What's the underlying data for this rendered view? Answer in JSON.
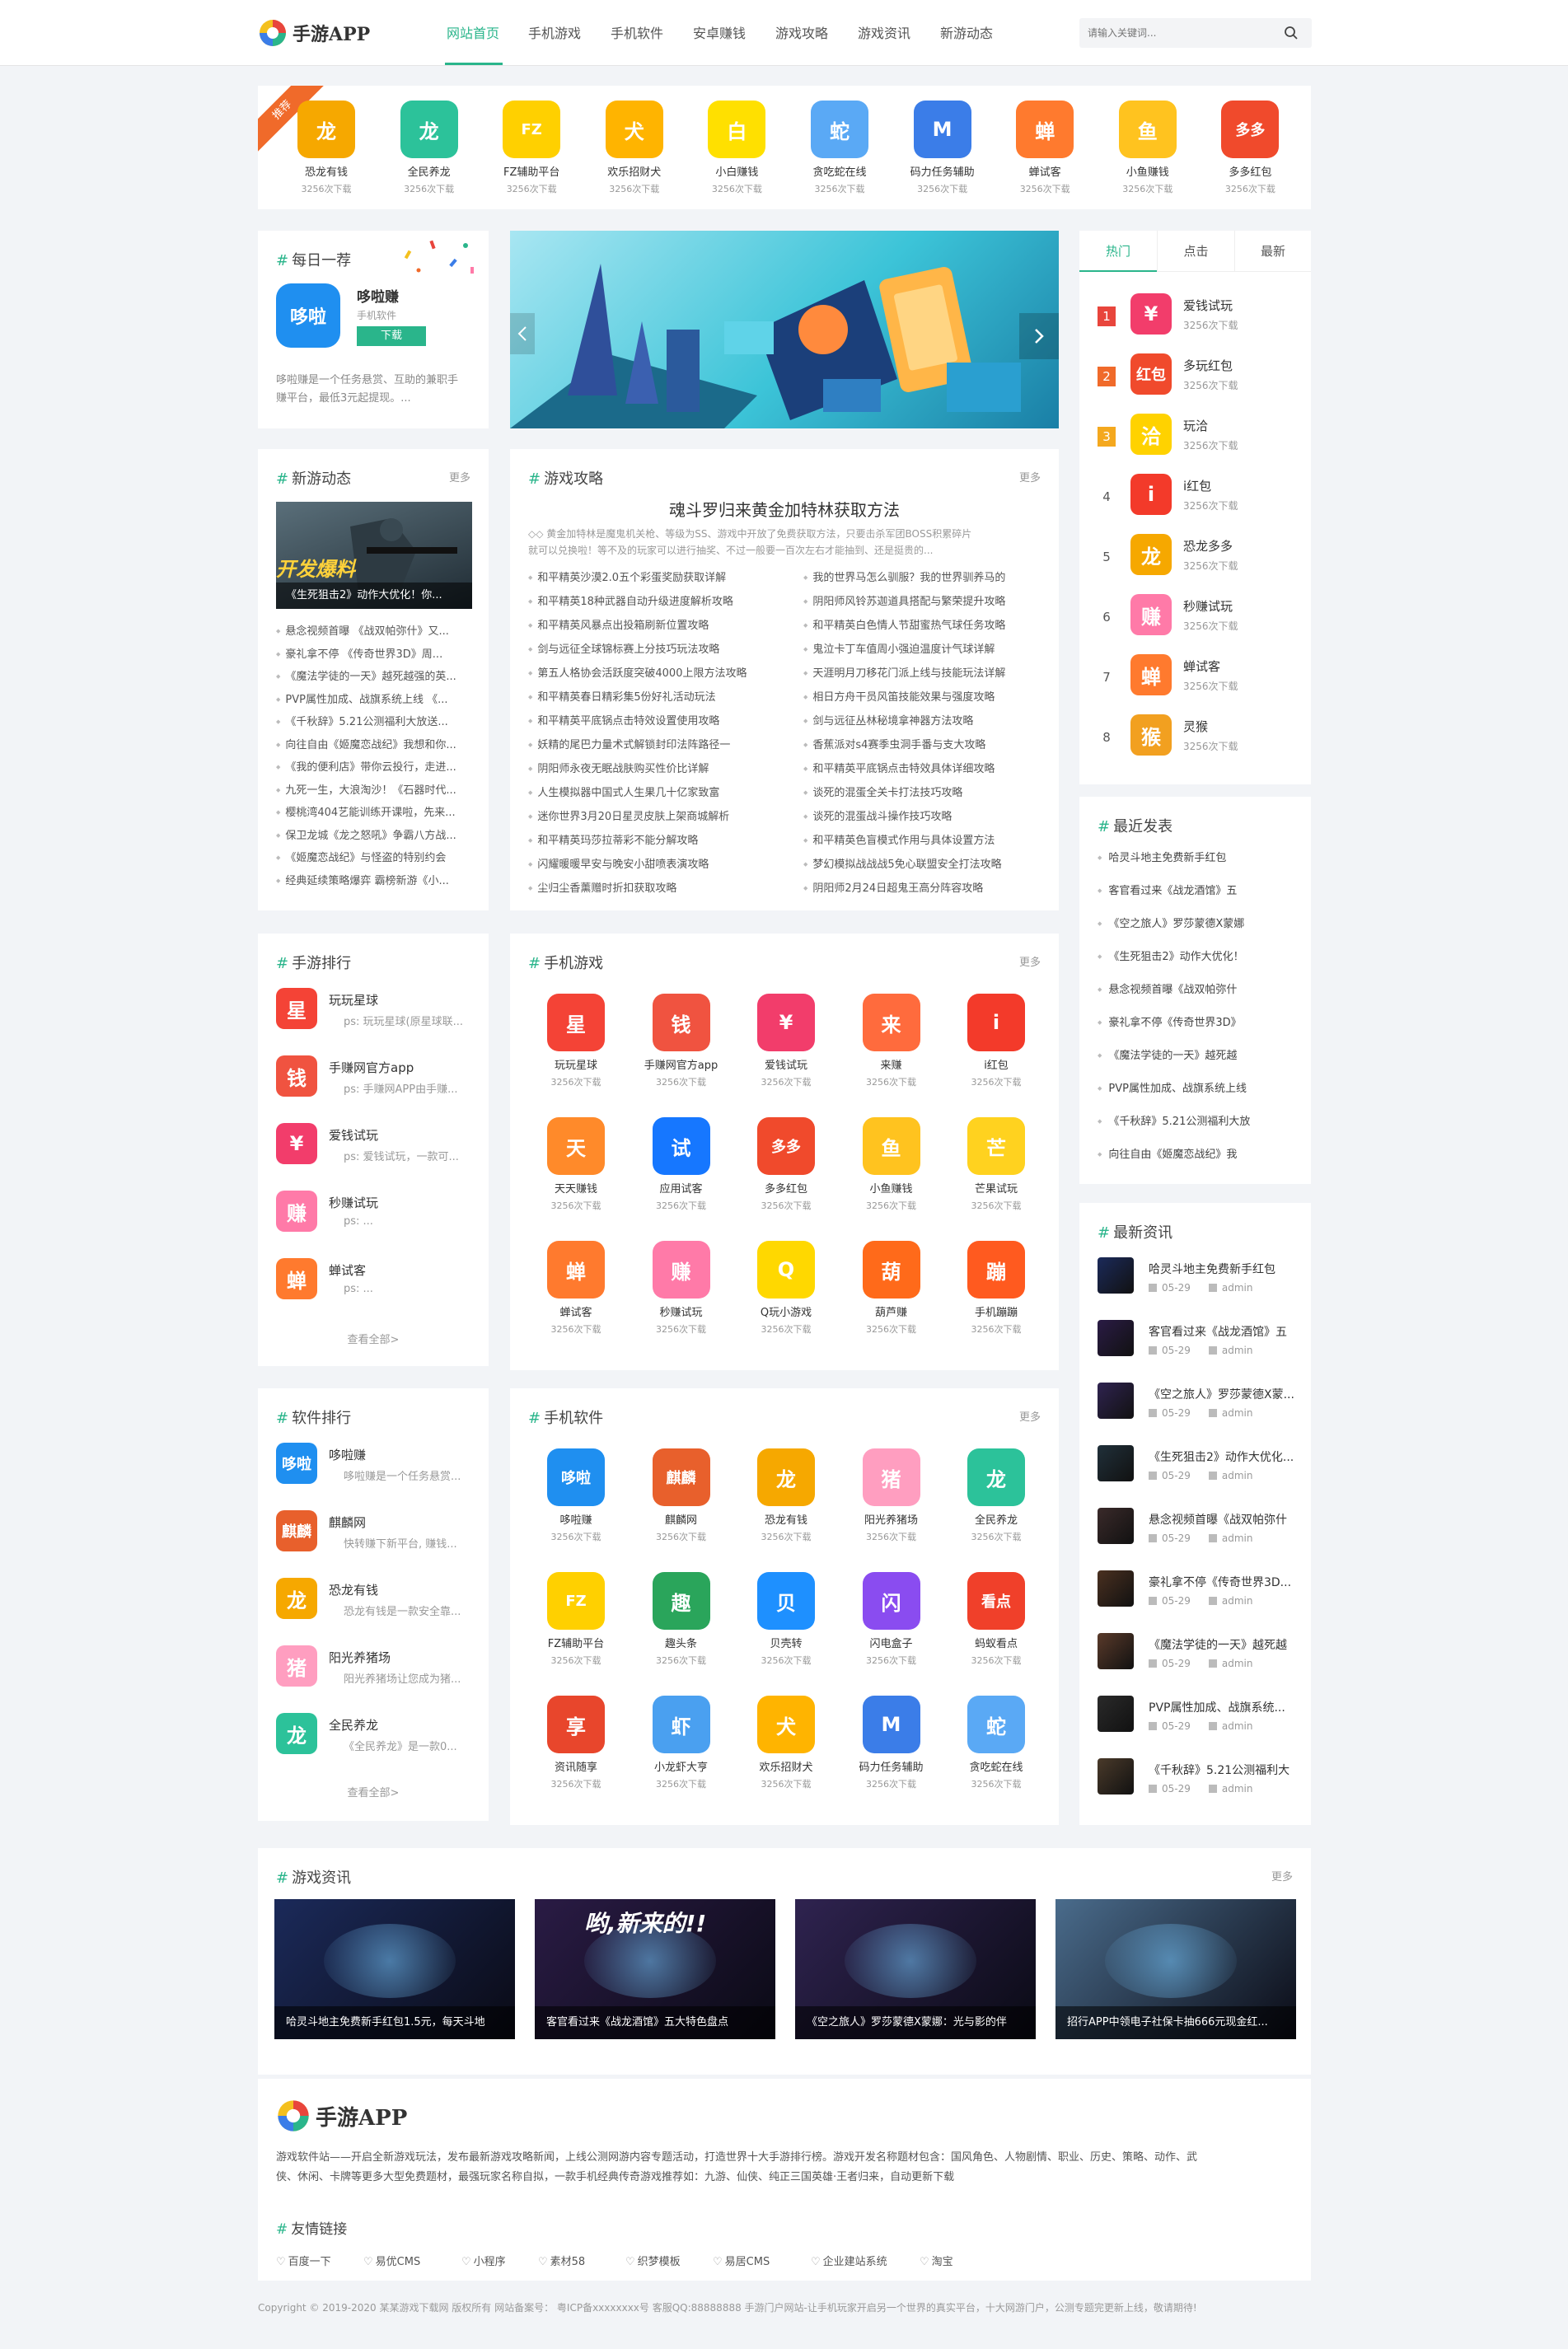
{
  "header": {
    "logo_text": "手游APP",
    "nav": [
      "网站首页",
      "手机游戏",
      "手机软件",
      "安卓赚钱",
      "游戏攻略",
      "游戏资讯",
      "新游动态"
    ],
    "search_placeholder": "请输入关键词..."
  },
  "top_apps": {
    "badge": "推荐",
    "items": [
      {
        "name": "恐龙有钱",
        "downloads": "3256次下载",
        "color": "#f6a800",
        "glyph": "龙"
      },
      {
        "name": "全民养龙",
        "downloads": "3256次下载",
        "color": "#2cc29a",
        "glyph": "龙"
      },
      {
        "name": "FZ辅助平台",
        "downloads": "3256次下载",
        "color": "#ffd000",
        "glyph": "FZ"
      },
      {
        "name": "欢乐招财犬",
        "downloads": "3256次下载",
        "color": "#ffb400",
        "glyph": "犬"
      },
      {
        "name": "小白赚钱",
        "downloads": "3256次下载",
        "color": "#ffe000",
        "glyph": "白"
      },
      {
        "name": "贪吃蛇在线",
        "downloads": "3256次下载",
        "color": "#5aa9f5",
        "glyph": "蛇"
      },
      {
        "name": "码力任务辅助",
        "downloads": "3256次下载",
        "color": "#3b7de8",
        "glyph": "M"
      },
      {
        "name": "蝉试客",
        "downloads": "3256次下载",
        "color": "#ff7a2e",
        "glyph": "蝉"
      },
      {
        "name": "小鱼赚钱",
        "downloads": "3256次下载",
        "color": "#ffc31f",
        "glyph": "鱼"
      },
      {
        "name": "多多红包",
        "downloads": "3256次下载",
        "color": "#f04a2c",
        "glyph": "多多"
      }
    ]
  },
  "daily": {
    "title": "每日一荐",
    "app_name": "哆啦赚",
    "app_cat": "手机软件",
    "icon_text": "哆啦",
    "download": "下载",
    "desc_line1": "哆啦赚是一个任务悬赏、互助的兼职手",
    "desc_line2": "赚平台，最低3元起提现。..."
  },
  "hot_tabs": [
    "热门",
    "点击",
    "最新"
  ],
  "hot_list": [
    {
      "rank": "1",
      "name": "爱钱试玩",
      "downloads": "3256次下载",
      "color": "#f23d6b",
      "glyph": "¥"
    },
    {
      "rank": "2",
      "name": "多玩红包",
      "downloads": "3256次下载",
      "color": "#f04a2c",
      "glyph": "红包"
    },
    {
      "rank": "3",
      "name": "玩洽",
      "downloads": "3256次下载",
      "color": "#ffd200",
      "glyph": "洽"
    },
    {
      "rank": "4",
      "name": "i红包",
      "downloads": "3256次下载",
      "color": "#f33a2a",
      "glyph": "i"
    },
    {
      "rank": "5",
      "name": "恐龙多多",
      "downloads": "3256次下载",
      "color": "#f6a800",
      "glyph": "龙"
    },
    {
      "rank": "6",
      "name": "秒赚试玩",
      "downloads": "3256次下载",
      "color": "#ff7aa8",
      "glyph": "赚"
    },
    {
      "rank": "7",
      "name": "蝉试客",
      "downloads": "3256次下载",
      "color": "#ff7a2e",
      "glyph": "蝉"
    },
    {
      "rank": "8",
      "name": "灵猴",
      "downloads": "3256次下载",
      "color": "#f2a020",
      "glyph": "猴"
    }
  ],
  "new_games": {
    "title": "新游动态",
    "more": "更多",
    "banner_text": "开发爆料",
    "banner_caption": "《生死狙击2》动作大优化！你...",
    "items": [
      "悬念视频首曝 《战双帕弥什》又...",
      "豪礼拿不停 《传奇世界3D》周...",
      "《魔法学徒的一天》越死越强的英...",
      "PVP属性加成、战旗系统上线 《...",
      "《千秋辞》5.21公测福利大放送...",
      "向往自由《姬魔恋战纪》我想和你...",
      "《我的便利店》带你云投行，走进...",
      "九死一生，大浪淘沙！《石器时代...",
      "樱桃湾404艺能训练开课啦，先来...",
      "保卫龙城《龙之怒吼》争霸八方战...",
      "《姬魔恋战纪》与怪盗的特别约会",
      "经典延续策略爆弈 霸榜新游《小..."
    ]
  },
  "guides": {
    "title": "游戏攻略",
    "more": "更多",
    "headline": "魂斗罗归来黄金加特林获取方法",
    "summary1": "◇◇ 黄金加特林是魔鬼机关枪、等级为SS、游戏中开放了免费获取方法，只要击杀军团BOSS积累碎片",
    "summary2": "就可以兑换啦！等不及的玩家可以进行抽奖、不过一般要一百次左右才能抽到、还是挺贵的...",
    "left": [
      "和平精英沙漠2.0五个彩蛋奖励获取详解",
      "和平精英18种武器自动升级进度解析攻略",
      "和平精英风暴点出投箱刷新位置攻略",
      "剑与远征全球锦标赛上分技巧玩法攻略",
      "第五人格协会活跃度突破4000上限方法攻略",
      "和平精英春日精彩集5份好礼活动玩法",
      "和平精英平底锅点击特效设置使用攻略",
      "妖精的尾巴力量术式解锁封印法阵路径一",
      "阴阳师永夜无眠战肤购买性价比详解",
      "人生模拟器中国式人生果几十亿家致富",
      "迷你世界3月20日星灵皮肤上架商城解析",
      "和平精英玛莎拉蒂彩不能分解攻略",
      "闪耀暖暖早安与晚安小甜喷表演攻略",
      "尘归尘香薰赠时折扣获取攻略"
    ],
    "right": [
      "我的世界马怎么驯服？我的世界驯养马的",
      "阴阳师风铃苏迦道具搭配与繁荣提升攻略",
      "和平精英白色情人节甜蜜热气球任务攻略",
      "鬼泣卡丁车值周小强迫温度计气球详解",
      "天涯明月刀移花门派上线与技能玩法详解",
      "相日方舟干员风笛技能效果与强度攻略",
      "剑与远征丛林秘境拿神器方法攻略",
      "香蕉派对s4赛季虫洞手番与支大攻略",
      "和平精英平底锅点击特效具体详细攻略",
      "谈死的混蛋全关卡打法技巧攻略",
      "谈死的混蛋战斗操作技巧攻略",
      "和平精英色盲模式作用与具体设置方法",
      "梦幻模拟战战战5免心联盟安全打法攻略",
      "阴阳师2月24日超鬼王高分阵容攻略"
    ]
  },
  "game_rank": {
    "title": "手游排行",
    "view_all": "查看全部>",
    "items": [
      {
        "name": "玩玩星球",
        "desc": "ps: 玩玩星球(原星球联...",
        "color": "#f44336",
        "glyph": "星"
      },
      {
        "name": "手赚网官方app",
        "desc": "ps: 手赚网APP由手赚...",
        "color": "#f05340",
        "glyph": "钱"
      },
      {
        "name": "爱钱试玩",
        "desc": "ps: 爱钱试玩，一款可...",
        "color": "#f23d6b",
        "glyph": "¥"
      },
      {
        "name": "秒赚试玩",
        "desc": "ps: ...",
        "color": "#ff7aa8",
        "glyph": "赚"
      },
      {
        "name": "蝉试客",
        "desc": "ps: ...",
        "color": "#ff7a2e",
        "glyph": "蝉"
      }
    ]
  },
  "mobile_games": {
    "title": "手机游戏",
    "more": "更多",
    "items": [
      {
        "name": "玩玩星球",
        "downloads": "3256次下载",
        "color": "#f44336",
        "glyph": "星"
      },
      {
        "name": "手赚网官方app",
        "downloads": "3256次下载",
        "color": "#f05340",
        "glyph": "钱"
      },
      {
        "name": "爱钱试玩",
        "downloads": "3256次下载",
        "color": "#f23d6b",
        "glyph": "¥"
      },
      {
        "name": "来赚",
        "downloads": "3256次下载",
        "color": "#ff6b3d",
        "glyph": "来"
      },
      {
        "name": "i红包",
        "downloads": "3256次下载",
        "color": "#f33a2a",
        "glyph": "i"
      },
      {
        "name": "天天赚钱",
        "downloads": "3256次下载",
        "color": "#ff8a2a",
        "glyph": "天"
      },
      {
        "name": "应用试客",
        "downloads": "3256次下载",
        "color": "#1677ff",
        "glyph": "试"
      },
      {
        "name": "多多红包",
        "downloads": "3256次下载",
        "color": "#f04a2c",
        "glyph": "多多"
      },
      {
        "name": "小鱼赚钱",
        "downloads": "3256次下载",
        "color": "#ffc31f",
        "glyph": "鱼"
      },
      {
        "name": "芒果试玩",
        "downloads": "3256次下载",
        "color": "#ffd21f",
        "glyph": "芒"
      },
      {
        "name": "蝉试客",
        "downloads": "3256次下载",
        "color": "#ff7a2e",
        "glyph": "蝉"
      },
      {
        "name": "秒赚试玩",
        "downloads": "3256次下载",
        "color": "#ff7aa8",
        "glyph": "赚"
      },
      {
        "name": "Q玩小游戏",
        "downloads": "3256次下载",
        "color": "#ffd800",
        "glyph": "Q"
      },
      {
        "name": "葫芦赚",
        "downloads": "3256次下载",
        "color": "#ff6a1a",
        "glyph": "葫"
      },
      {
        "name": "手机蹦蹦",
        "downloads": "3256次下载",
        "color": "#ff5a1f",
        "glyph": "蹦"
      }
    ]
  },
  "soft_rank": {
    "title": "软件排行",
    "view_all": "查看全部>",
    "items": [
      {
        "name": "哆啦赚",
        "desc": "哆啦赚是一个任务悬赏...",
        "color": "#1f8ff0",
        "glyph": "哆啦"
      },
      {
        "name": "麒麟网",
        "desc": "快转赚下新平台, 赚钱...",
        "color": "#e8602c",
        "glyph": "麒麟"
      },
      {
        "name": "恐龙有钱",
        "desc": "恐龙有钱是一款安全靠...",
        "color": "#f6a800",
        "glyph": "龙"
      },
      {
        "name": "阳光养猪场",
        "desc": "阳光养猪场让您成为猪...",
        "color": "#ff9ec0",
        "glyph": "猪"
      },
      {
        "name": "全民养龙",
        "desc": "《全民养龙》是一款0...",
        "color": "#2cc29a",
        "glyph": "龙"
      }
    ]
  },
  "mobile_soft": {
    "title": "手机软件",
    "more": "更多",
    "items": [
      {
        "name": "哆啦赚",
        "downloads": "3256次下载",
        "color": "#1f8ff0",
        "glyph": "哆啦"
      },
      {
        "name": "麒麟网",
        "downloads": "3256次下载",
        "color": "#e8602c",
        "glyph": "麒麟"
      },
      {
        "name": "恐龙有钱",
        "downloads": "3256次下载",
        "color": "#f6a800",
        "glyph": "龙"
      },
      {
        "name": "阳光养猪场",
        "downloads": "3256次下载",
        "color": "#ff9ec0",
        "glyph": "猪"
      },
      {
        "name": "全民养龙",
        "downloads": "3256次下载",
        "color": "#2cc29a",
        "glyph": "龙"
      },
      {
        "name": "FZ辅助平台",
        "downloads": "3256次下载",
        "color": "#ffd000",
        "glyph": "FZ"
      },
      {
        "name": "趣头条",
        "downloads": "3256次下载",
        "color": "#2aa55b",
        "glyph": "趣"
      },
      {
        "name": "贝壳转",
        "downloads": "3256次下载",
        "color": "#1e90ff",
        "glyph": "贝"
      },
      {
        "name": "闪电盒子",
        "downloads": "3256次下载",
        "color": "#8a4cf0",
        "glyph": "闪"
      },
      {
        "name": "蚂蚁看点",
        "downloads": "3256次下载",
        "color": "#f0402a",
        "glyph": "看点"
      },
      {
        "name": "资讯随享",
        "downloads": "3256次下载",
        "color": "#e8462c",
        "glyph": "享"
      },
      {
        "name": "小龙虾大亨",
        "downloads": "3256次下载",
        "color": "#4aa0f0",
        "glyph": "虾"
      },
      {
        "name": "欢乐招财犬",
        "downloads": "3256次下载",
        "color": "#ffb400",
        "glyph": "犬"
      },
      {
        "name": "码力任务辅助",
        "downloads": "3256次下载",
        "color": "#3b7de8",
        "glyph": "M"
      },
      {
        "name": "贪吃蛇在线",
        "downloads": "3256次下载",
        "color": "#5aa9f5",
        "glyph": "蛇"
      }
    ]
  },
  "recent": {
    "title": "最近发表",
    "items": [
      "哈灵斗地主免费新手红包",
      "客官看过来《战龙酒馆》五",
      "《空之旅人》罗莎蒙德X蒙娜",
      "《生死狙击2》动作大优化！",
      "悬念视频首曝《战双帕弥什",
      "豪礼拿不停《传奇世界3D》",
      "《魔法学徒的一天》越死越",
      "PVP属性加成、战旗系统上线",
      "《千秋辞》5.21公测福利大放",
      "向往自由《姬魔恋战纪》我"
    ]
  },
  "latest": {
    "title": "最新资讯",
    "items": [
      {
        "title": "哈灵斗地主免费新手红包",
        "date": "05-29",
        "author": "admin"
      },
      {
        "title": "客官看过来《战龙酒馆》五",
        "date": "05-29",
        "author": "admin"
      },
      {
        "title": "《空之旅人》罗莎蒙德X蒙...",
        "date": "05-29",
        "author": "admin"
      },
      {
        "title": "《生死狙击2》动作大优化...",
        "date": "05-29",
        "author": "admin"
      },
      {
        "title": "悬念视频首曝《战双帕弥什",
        "date": "05-29",
        "author": "admin"
      },
      {
        "title": "豪礼拿不停《传奇世界3D...",
        "date": "05-29",
        "author": "admin"
      },
      {
        "title": "《魔法学徒的一天》越死越",
        "date": "05-29",
        "author": "admin"
      },
      {
        "title": "PVP属性加成、战旗系统...",
        "date": "05-29",
        "author": "admin"
      },
      {
        "title": "《千秋辞》5.21公测福利大",
        "date": "05-29",
        "author": "admin"
      }
    ]
  },
  "game_news": {
    "title": "游戏资讯",
    "more": "更多",
    "cards": [
      {
        "caption": "哈灵斗地主免费新手红包1.5元，每天斗地",
        "bg": "#1b2a5a"
      },
      {
        "caption": "客官看过来《战龙酒馆》五大特色盘点",
        "bg": "#2a1b45",
        "overlay": "哟,新来的!!"
      },
      {
        "caption": "《空之旅人》罗莎蒙德X蒙娜：光与影的伴",
        "bg": "#2f2350"
      },
      {
        "caption": "招行APP中领电子社保卡抽666元现金红...",
        "bg": "#4a6c8c"
      }
    ]
  },
  "footer": {
    "logo_text": "手游APP",
    "desc1": "游戏软件站——开启全新游戏玩法，发布最新游戏攻略新闻，上线公测网游内容专题活动，打造世界十大手游排行榜。游戏开发名称题材包含：国风角色、人物剧情、职业、历史、策略、动作、武",
    "desc2": "侠、休闲、卡牌等更多大型免费题材，最强玩家名称自拟，一款手机经典传奇游戏推荐如：九游、仙侠、纯正三国英雄·王者归来，自动更新下载",
    "links_title": "友情链接",
    "links": [
      "百度一下",
      "易优CMS",
      "小程序",
      "素材58",
      "织梦模板",
      "易居CMS",
      "企业建站系统",
      "淘宝"
    ],
    "copyright": "Copyright © 2019-2020 某某游戏下载网 版权所有 网站备案号：  粤ICP备xxxxxxxx号    客服QQ:88888888 手游门户网站-让手机玩家开启另一个世界的真实平台，十大网游门户，公测专题完更新上线，敬请期待!"
  }
}
